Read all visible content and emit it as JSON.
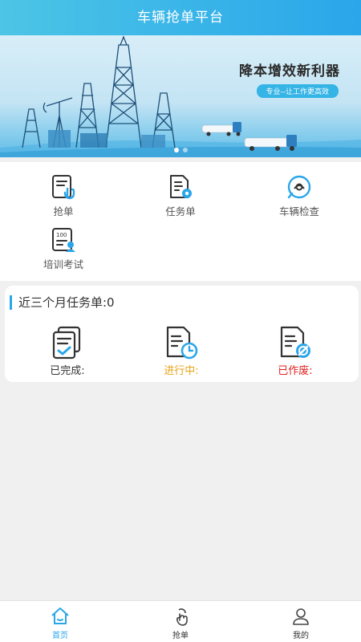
{
  "header": {
    "title": "车辆抢单平台"
  },
  "banner": {
    "title": "降本增效新利器",
    "subtitle": "专业--让工作更高效"
  },
  "menu": [
    {
      "label": "抢单",
      "icon": "grab-order-icon"
    },
    {
      "label": "任务单",
      "icon": "task-order-icon"
    },
    {
      "label": "车辆检查",
      "icon": "vehicle-check-icon"
    },
    {
      "label": "培训考试",
      "icon": "training-exam-icon"
    }
  ],
  "summary": {
    "title": "近三个月任务单:0",
    "stats": [
      {
        "label": "已完成:",
        "color": "#333333",
        "icon": "completed-icon"
      },
      {
        "label": "进行中:",
        "color": "#e8a317",
        "icon": "in-progress-icon"
      },
      {
        "label": "已作废:",
        "color": "#e02020",
        "icon": "voided-icon"
      }
    ]
  },
  "tabbar": [
    {
      "label": "首页",
      "icon": "home-icon",
      "active": true
    },
    {
      "label": "抢单",
      "icon": "tap-hand-icon",
      "active": false
    },
    {
      "label": "我的",
      "icon": "user-icon",
      "active": false
    }
  ],
  "colors": {
    "accent": "#2aa6ea",
    "header_start": "#4cc5e6",
    "progress": "#e8a317",
    "void": "#e02020"
  }
}
